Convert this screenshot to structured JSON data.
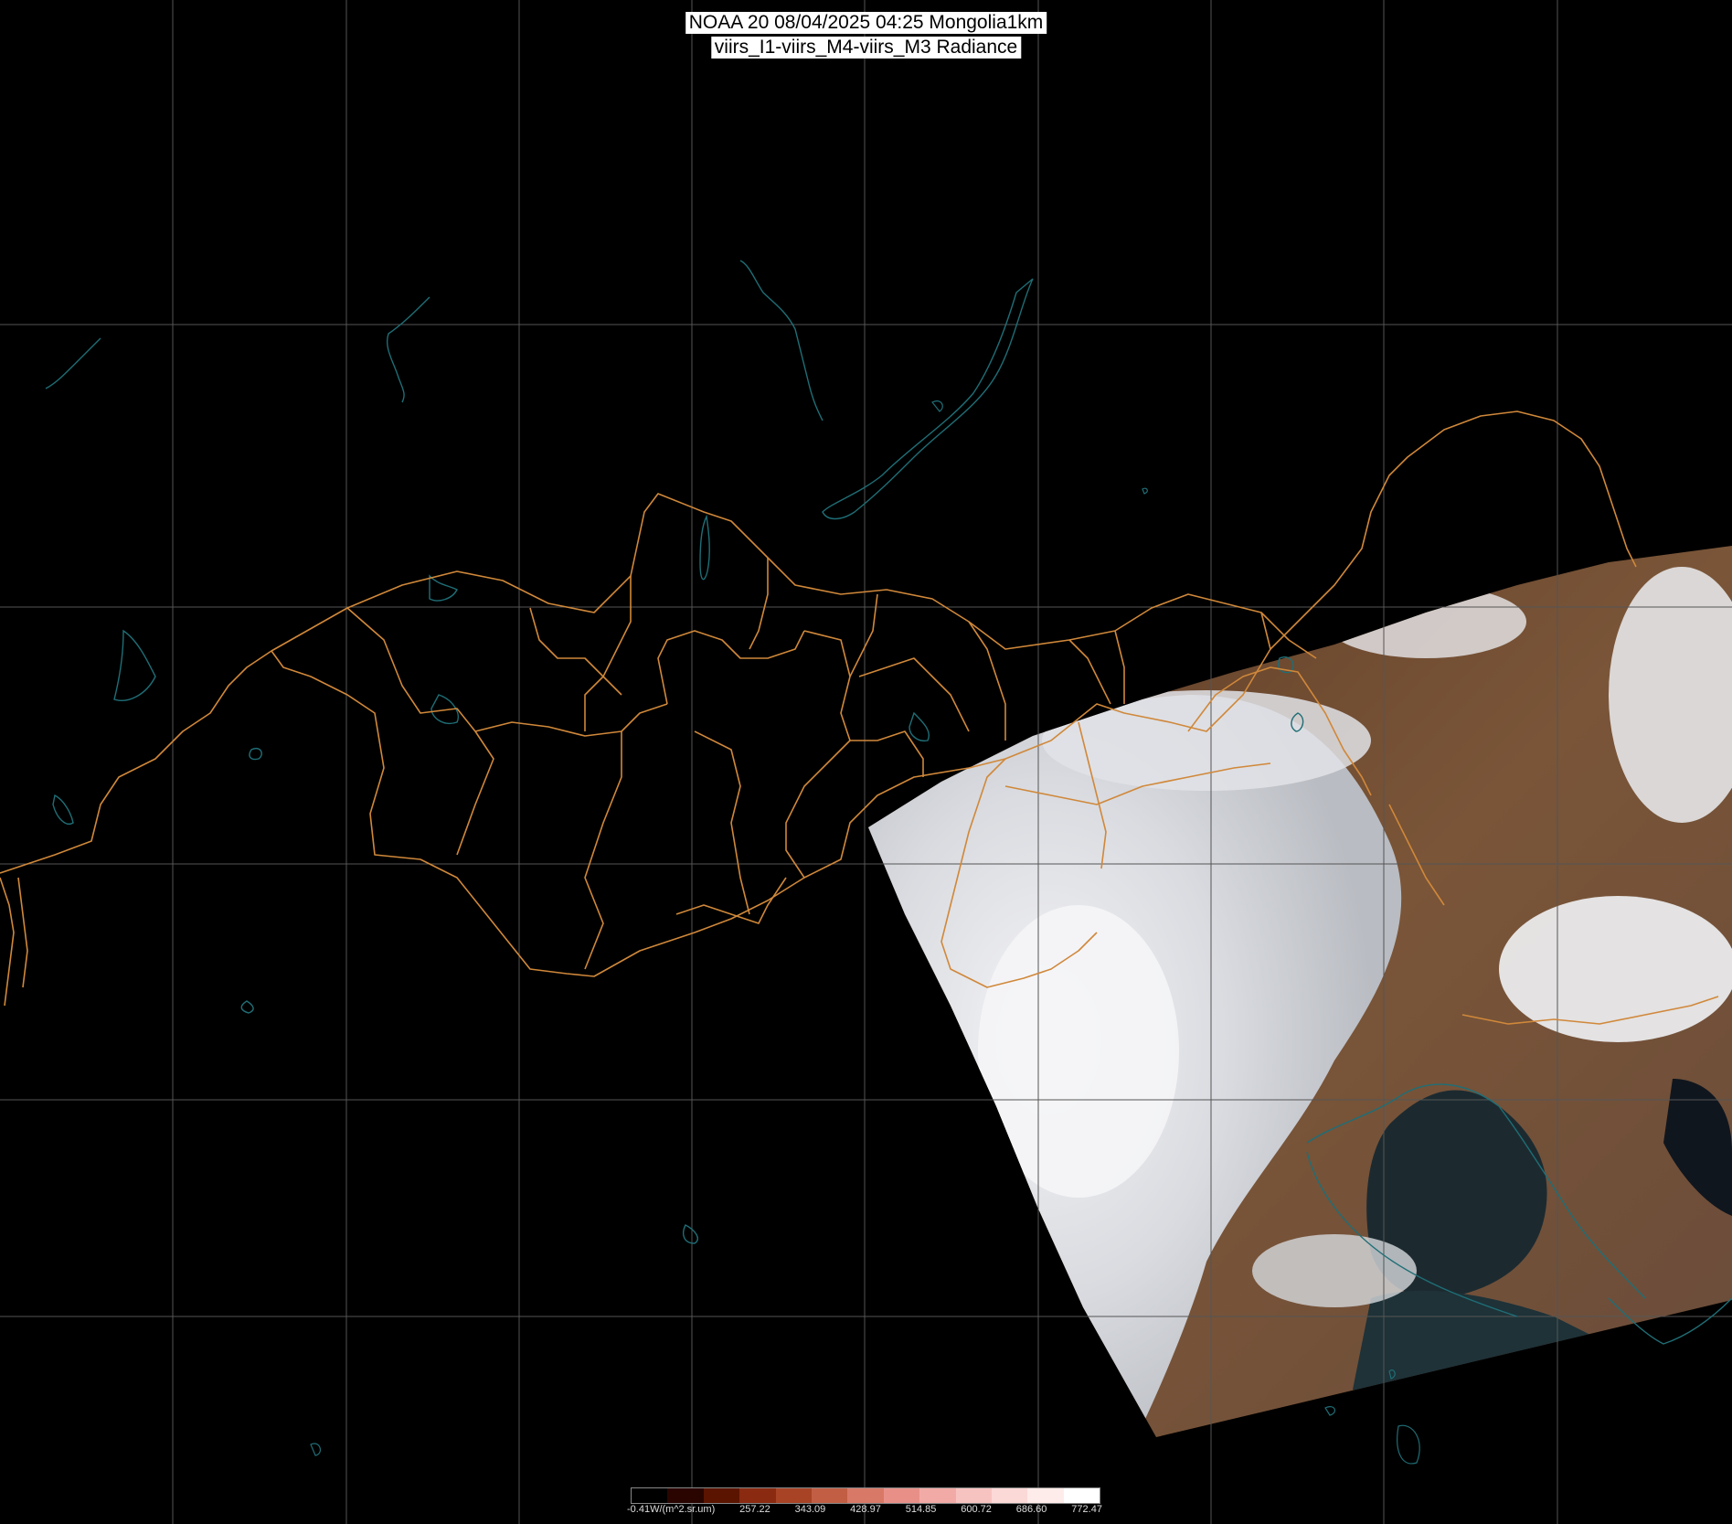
{
  "title": {
    "line1": "NOAA 20 08/04/2025 04:25 Mongolia1km",
    "line2": "viirs_I1-viirs_M4-viirs_M3 Radiance"
  },
  "colors": {
    "background": "#000000",
    "grid": "#555555",
    "borders": "#d0883a",
    "water": "#1f6e76",
    "cloud": "#e8e8ec",
    "land": "#6a4a34"
  },
  "colorbar": {
    "unit_label": "-0.41W/(m^2.sr.um)",
    "tick_labels": [
      "257.22",
      "343.09",
      "428.97",
      "514.85",
      "600.72",
      "686.60",
      "772.47"
    ],
    "colors": [
      "#000000",
      "#2a0500",
      "#5a1400",
      "#8a2a10",
      "#a84326",
      "#c25e44",
      "#d87866",
      "#e89088",
      "#f2aaa6",
      "#f7c3c0",
      "#fbd9d7",
      "#feecea",
      "#ffffff"
    ]
  }
}
